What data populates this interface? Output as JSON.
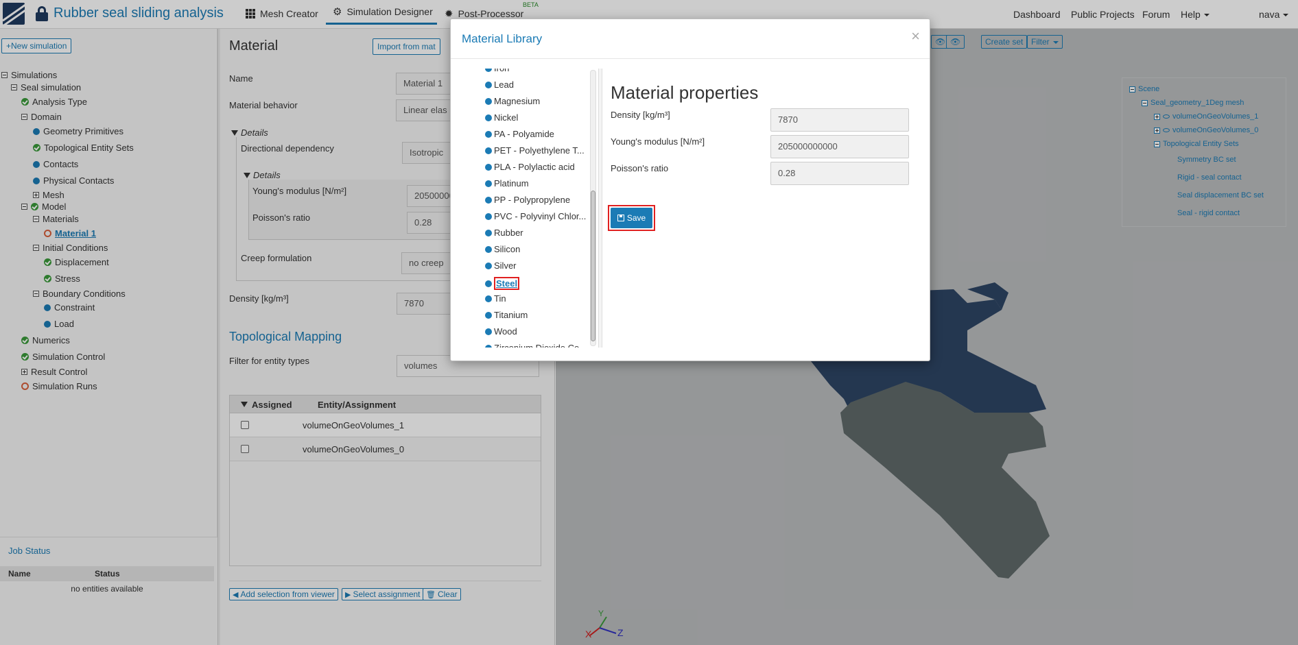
{
  "app": {
    "title": "Rubber seal sliding analysis"
  },
  "nav": {
    "tabs": [
      {
        "label": "Mesh Creator"
      },
      {
        "label": "Simulation Designer"
      },
      {
        "label": "Post-Processor"
      }
    ],
    "beta": "BETA",
    "right": {
      "dashboard": "Dashboard",
      "public_projects": "Public Projects",
      "forum": "Forum",
      "help": "Help",
      "user": "nava"
    }
  },
  "sidebar": {
    "new_simulation": "+New simulation",
    "tree": {
      "root": "Simulations",
      "seal_simulation": "Seal simulation",
      "analysis_type": "Analysis Type",
      "domain": "Domain",
      "geometry_primitives": "Geometry Primitives",
      "topological_entity_sets": "Topological Entity Sets",
      "contacts": "Contacts",
      "physical_contacts": "Physical Contacts",
      "mesh": "Mesh",
      "model": "Model",
      "materials": "Materials",
      "material_1": "Material 1",
      "initial_conditions": "Initial Conditions",
      "displacement": "Displacement",
      "stress": "Stress",
      "boundary_conditions": "Boundary Conditions",
      "constraint": "Constraint",
      "load": "Load",
      "numerics": "Numerics",
      "simulation_control": "Simulation Control",
      "result_control": "Result Control",
      "simulation_runs": "Simulation Runs"
    }
  },
  "job_status": {
    "title": "Job Status",
    "col_name": "Name",
    "col_status": "Status",
    "empty": "no entities available"
  },
  "material_panel": {
    "title": "Material",
    "import_button": "Import from mat",
    "name_label": "Name",
    "name_value": "Material 1",
    "behavior_label": "Material behavior",
    "behavior_value": "Linear elas",
    "details_label": "Details",
    "directional_label": "Directional dependency",
    "directional_value": "Isotropic",
    "inner_details_label": "Details",
    "youngs_label": "Young's modulus [N/m²]",
    "youngs_value": "20500000",
    "poisson_label": "Poisson's ratio",
    "poisson_value": "0.28",
    "creep_label": "Creep formulation",
    "creep_value": "no creep",
    "density_label": "Density [kg/m³]",
    "density_value": "7870"
  },
  "topological_mapping": {
    "title": "Topological Mapping",
    "filter_label": "Filter for entity types",
    "filter_value": "volumes",
    "col_assigned": "Assigned",
    "col_entity": "Entity/Assignment",
    "rows": [
      {
        "entity": "volumeOnGeoVolumes_1"
      },
      {
        "entity": "volumeOnGeoVolumes_0"
      }
    ],
    "add_selection": "Add selection from viewer",
    "select_assignment": "Select assignment",
    "clear": "Clear"
  },
  "viewer": {
    "toolbar": {
      "create_set": "Create set",
      "filter": "Filter"
    },
    "scene": {
      "root": "Scene",
      "mesh": "Seal_geometry_1Deg mesh",
      "vol1": "volumeOnGeoVolumes_1",
      "vol0": "volumeOnGeoVolumes_0",
      "topo": "Topological Entity Sets",
      "sets": [
        "Symmetry BC set",
        "Rigid - seal contact",
        "Seal displacement BC set",
        "Seal - rigid contact"
      ]
    },
    "axes": {
      "x": "X",
      "y": "Y",
      "z": "Z"
    },
    "colors": {
      "dark_part": "#2d4565",
      "light_part": "#5f6a6a",
      "background": "#bbbdbf"
    }
  },
  "material_library": {
    "title": "Material Library",
    "close": "×",
    "materials": [
      "Iron",
      "Lead",
      "Magnesium",
      "Nickel",
      "PA - Polyamide",
      "PET - Polyethylene T...",
      "PLA - Polylactic acid",
      "Platinum",
      "PP - Polypropylene",
      "PVC - Polyvinyl Chlor...",
      "Rubber",
      "Silicon",
      "Silver",
      "Steel",
      "Tin",
      "Titanium",
      "Wood",
      "Zirconium Dioxide Ce..."
    ],
    "selected": "Steel",
    "properties_title": "Material properties",
    "density_label": "Density [kg/m³]",
    "density_value": "7870",
    "youngs_label": "Young's modulus [N/m²]",
    "youngs_value": "205000000000",
    "poisson_label": "Poisson's ratio",
    "poisson_value": "0.28",
    "save": "Save"
  }
}
